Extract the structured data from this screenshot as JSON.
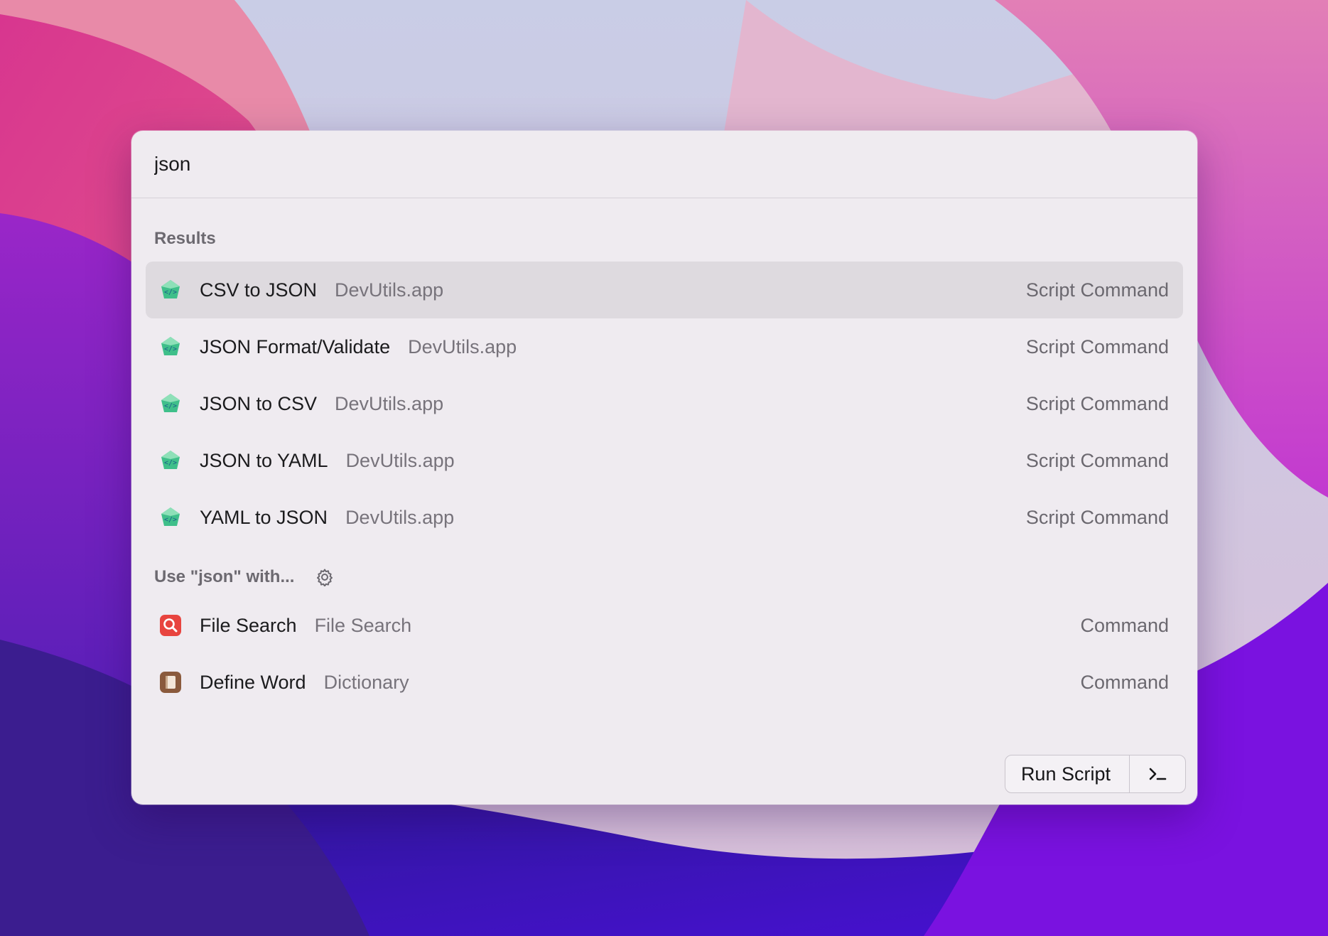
{
  "search": {
    "query": "json"
  },
  "sections": {
    "results_header": "Results",
    "fallback_header": "Use \"json\" with..."
  },
  "results": [
    {
      "title": "CSV to JSON",
      "subtitle": "DevUtils.app",
      "kind": "Script Command",
      "icon": "devutils-icon",
      "selected": true
    },
    {
      "title": "JSON Format/Validate",
      "subtitle": "DevUtils.app",
      "kind": "Script Command",
      "icon": "devutils-icon",
      "selected": false
    },
    {
      "title": "JSON to CSV",
      "subtitle": "DevUtils.app",
      "kind": "Script Command",
      "icon": "devutils-icon",
      "selected": false
    },
    {
      "title": "JSON to YAML",
      "subtitle": "DevUtils.app",
      "kind": "Script Command",
      "icon": "devutils-icon",
      "selected": false
    },
    {
      "title": "YAML to JSON",
      "subtitle": "DevUtils.app",
      "kind": "Script Command",
      "icon": "devutils-icon",
      "selected": false
    }
  ],
  "fallbacks": [
    {
      "title": "File Search",
      "subtitle": "File Search",
      "kind": "Command",
      "icon": "file-search-icon"
    },
    {
      "title": "Define Word",
      "subtitle": "Dictionary",
      "kind": "Command",
      "icon": "dictionary-icon"
    }
  ],
  "action_bar": {
    "primary_label": "Run Script",
    "secondary_icon": "terminal-icon"
  },
  "colors": {
    "panel_bg": "#efebf0",
    "selected_row": "#dedadf",
    "devutils_green": "#3fbf8a",
    "file_search_red": "#e8443f",
    "dictionary_brown": "#8a5a3c"
  }
}
